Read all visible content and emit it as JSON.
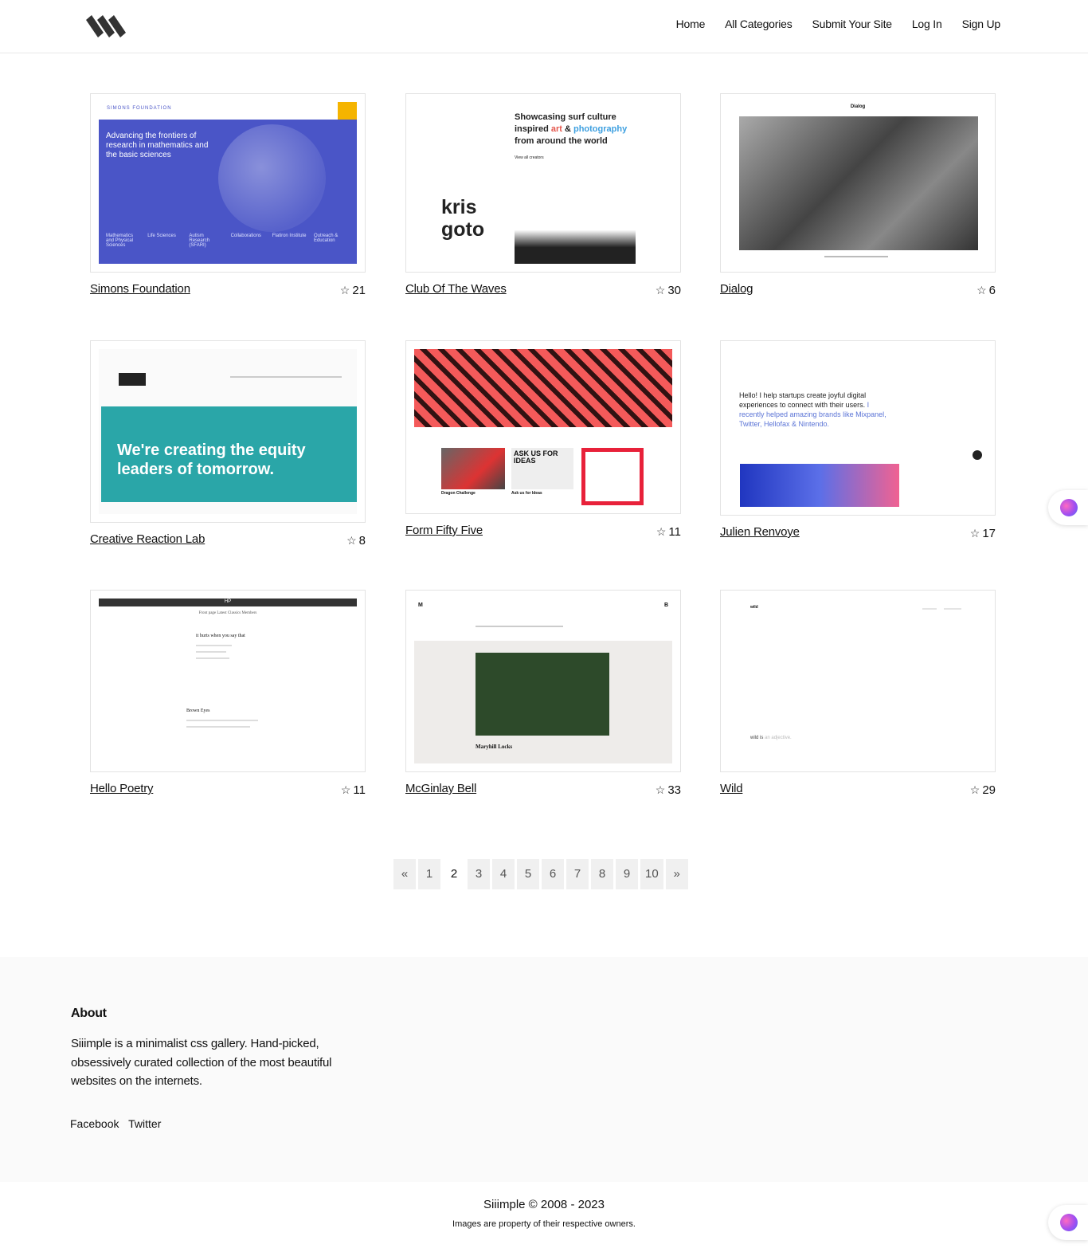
{
  "header": {
    "logo_alt": "Siiimple",
    "nav": [
      "Home",
      "All Categories",
      "Submit Your Site",
      "Log In",
      "Sign Up"
    ]
  },
  "cards": [
    {
      "title": "Simons Foundation",
      "stars": "21",
      "thumb": {
        "nav_brand": "SIMONS FOUNDATION",
        "headline": "Advancing the frontiers of research in mathematics and the basic sciences",
        "links": [
          "Mathematics and Physical Sciences",
          "Life Sciences",
          "Autism Research (SFARI)",
          "Collaborations",
          "Flatiron Institute",
          "Outreach & Education"
        ]
      }
    },
    {
      "title": "Club Of The Waves",
      "stars": "30",
      "thumb": {
        "headline_1": "Showcasing surf culture",
        "headline_2a": "inspired ",
        "headline_art": "art",
        "headline_amp": " & ",
        "headline_photo": "photography",
        "headline_3": "from around the world",
        "artist": "kris goto",
        "view_all": "View all creators"
      }
    },
    {
      "title": "Dialog",
      "stars": "6",
      "thumb": {
        "brand": "Dialog"
      }
    },
    {
      "title": "Creative Reaction Lab",
      "stars": "8",
      "thumb": {
        "headline": "We're creating the equity leaders of tomorrow."
      }
    },
    {
      "title": "Form Fifty Five",
      "stars": "11",
      "thumb": {
        "items": [
          "Dragon Challenge",
          "Ask us for Ideas"
        ],
        "promo": "ASK US FOR IDEAS"
      }
    },
    {
      "title": "Julien Renvoye",
      "stars": "17",
      "thumb": {
        "text_a": "Hello! I help startups create joyful digital experiences to connect with their users.",
        "text_b": "I recently helped amazing brands like Mixpanel, Twitter, Hellofax & Nintendo."
      }
    },
    {
      "title": "Hello Poetry",
      "stars": "11",
      "thumb": {
        "brand": "HP",
        "tabs": "Front page  Latest  Classics  Members",
        "poem_title": "it hurts when you say that",
        "poem_2": "Brown Eyes"
      }
    },
    {
      "title": "McGinlay Bell",
      "stars": "33",
      "thumb": {
        "m": "M",
        "b": "B",
        "project": "Maryhill Locks"
      }
    },
    {
      "title": "Wild",
      "stars": "29",
      "thumb": {
        "brand": "wild",
        "tagline_a": "wild is ",
        "tagline_b": "an adjective."
      }
    }
  ],
  "pagination": {
    "prev": "«",
    "pages": [
      "1",
      "2",
      "3",
      "4",
      "5",
      "6",
      "7",
      "8",
      "9",
      "10"
    ],
    "next": "»",
    "current": "2"
  },
  "footer": {
    "about_heading": "About",
    "about_text": "Siiimple is a minimalist css gallery. Hand-picked, obsessively curated collection of the most beautiful websites on the internets.",
    "social": [
      "Facebook",
      "Twitter"
    ],
    "copyright": "Siiimple © 2008 - 2023",
    "rights": "Images are property of their respective owners."
  },
  "colors": {
    "accent": "#4a55c7",
    "teal": "#2aa6a8",
    "red": "#f45a5a"
  }
}
